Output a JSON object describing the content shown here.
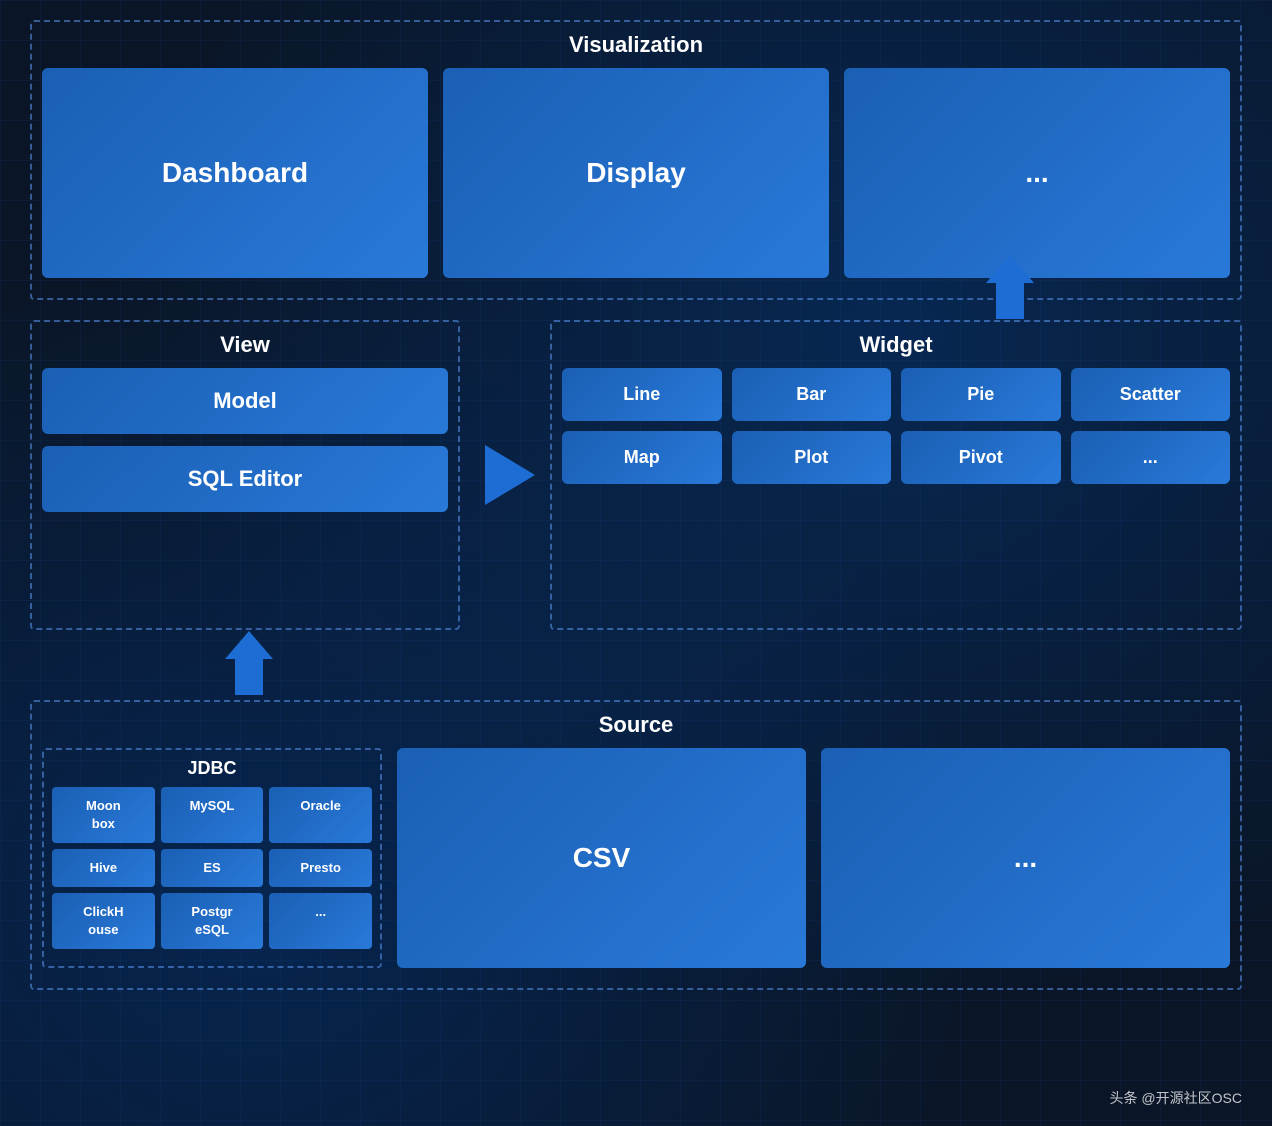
{
  "visualization": {
    "title": "Visualization",
    "cards": [
      {
        "label": "Dashboard"
      },
      {
        "label": "Display"
      },
      {
        "label": "..."
      }
    ]
  },
  "view": {
    "title": "View",
    "cards": [
      {
        "label": "Model"
      },
      {
        "label": "SQL Editor"
      }
    ]
  },
  "widget": {
    "title": "Widget",
    "grid": [
      {
        "label": "Line"
      },
      {
        "label": "Bar"
      },
      {
        "label": "Pie"
      },
      {
        "label": "Scatter"
      },
      {
        "label": "Map"
      },
      {
        "label": "Plot"
      },
      {
        "label": "Pivot"
      },
      {
        "label": "..."
      }
    ]
  },
  "source": {
    "title": "Source",
    "jdbc": {
      "title": "JDBC",
      "cells": [
        {
          "label": "Moon\nbox"
        },
        {
          "label": "MySQL"
        },
        {
          "label": "Oracle"
        },
        {
          "label": "Hive"
        },
        {
          "label": "ES"
        },
        {
          "label": "Presto"
        },
        {
          "label": "ClickH\nouse"
        },
        {
          "label": "Postgr\neSQL"
        },
        {
          "label": "..."
        }
      ]
    },
    "csv": {
      "label": "CSV"
    },
    "ellipsis": {
      "label": "..."
    }
  },
  "watermark": "头条 @开源社区OSC"
}
